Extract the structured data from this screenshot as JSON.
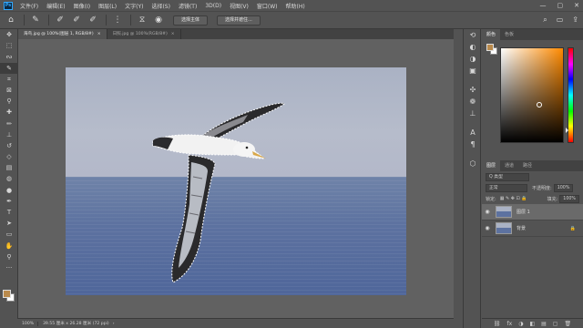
{
  "menubar": {
    "logo": "Ps",
    "items": [
      "文件(F)",
      "编辑(E)",
      "图像(I)",
      "图层(L)",
      "文字(Y)",
      "选择(S)",
      "滤镜(T)",
      "3D(D)",
      "视图(V)",
      "窗口(W)",
      "帮助(H)"
    ],
    "window_controls": [
      "—",
      "▢",
      "✕"
    ]
  },
  "options": {
    "select_subject": "选择主体",
    "select_and_mask": "选择并遮住..."
  },
  "tabs": [
    {
      "label": "海鸟.jpg @ 100%(图层 1, RGB/8#)",
      "close": "×"
    },
    {
      "label": "日照.jpg @ 100%(RGB/8#)",
      "close": "×"
    }
  ],
  "status": {
    "zoom": "100%",
    "info": "39.55 厘米 x 26.28 厘米 (72 ppi)",
    "arrow": "›"
  },
  "color_panel": {
    "tabs": [
      "颜色",
      "色板"
    ],
    "foreground": "#b98a4c",
    "background": "#ffffff",
    "hue": "#ff8a00"
  },
  "layers_panel": {
    "tabs": [
      "图层",
      "通道",
      "路径"
    ],
    "filter_label": "Q 类型",
    "blend_mode": "正常",
    "opacity_label": "不透明度:",
    "opacity_value": "100%",
    "lock_label": "锁定:",
    "fill_label": "填充:",
    "fill_value": "100%",
    "layers": [
      {
        "name": "图层 1",
        "selected": true
      },
      {
        "name": "背景",
        "selected": false,
        "locked": true
      }
    ],
    "bottom_icons": [
      "fx",
      "◑",
      "◧",
      "▤",
      "▢",
      "🗑"
    ]
  },
  "colors": {
    "ui_bg": "#535353",
    "canvas_bg": "#616161",
    "accent": "#31a8ff"
  }
}
